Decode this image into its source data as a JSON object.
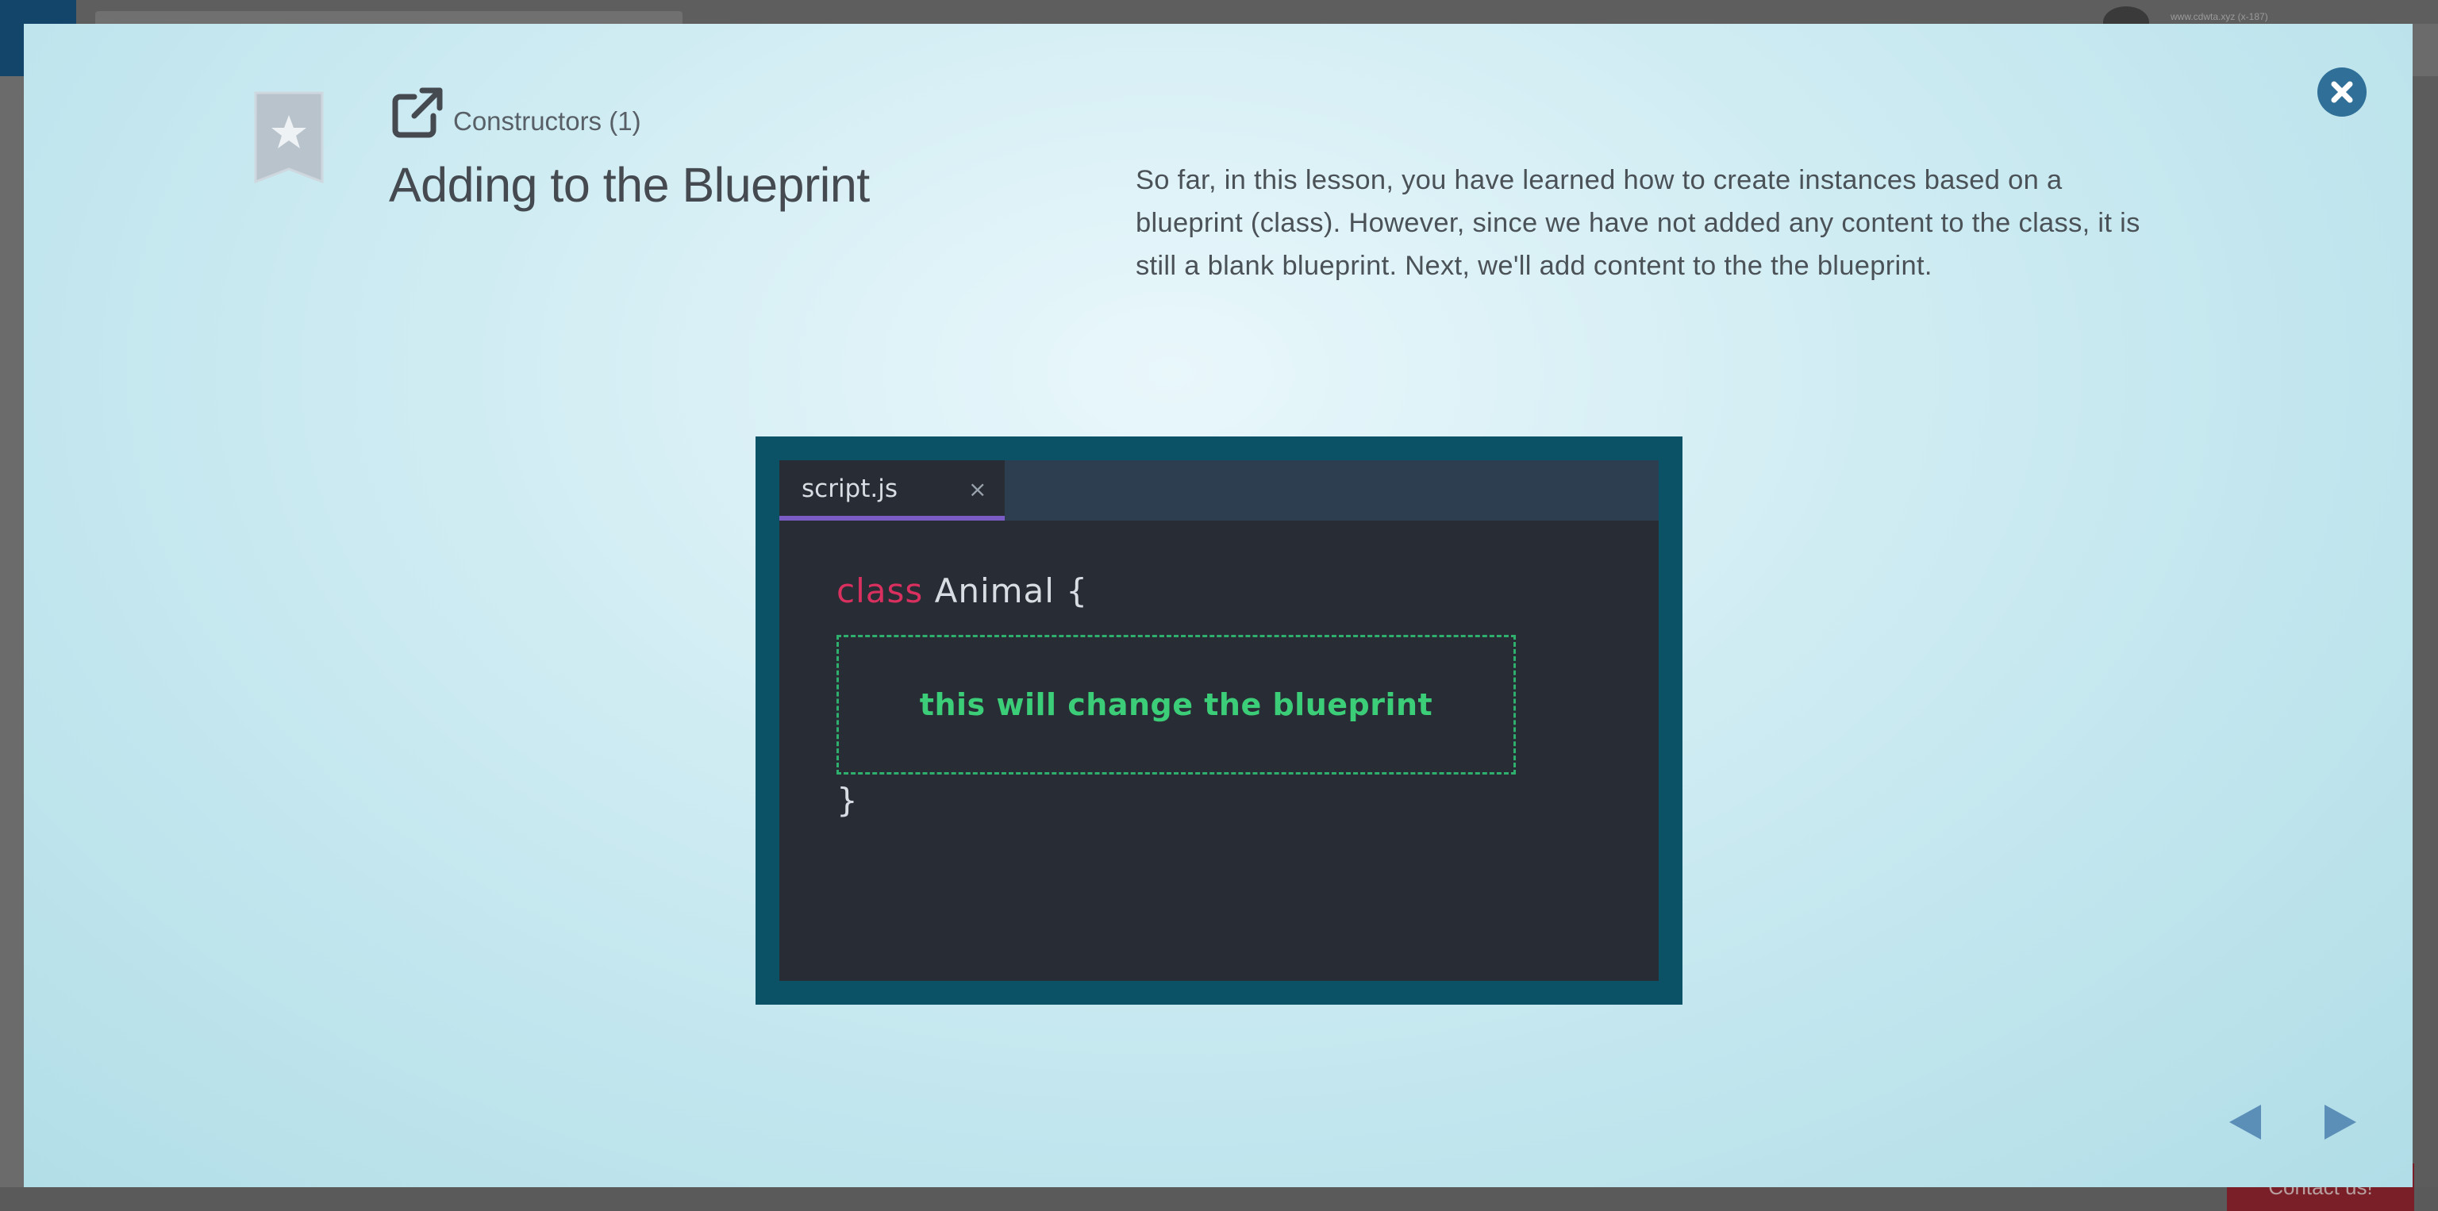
{
  "background_page": {
    "user_label": "www.cdwta.xyz (x-187)",
    "contact_label": "Contact us!"
  },
  "lesson": {
    "breadcrumb": "Constructors (1)",
    "title": "Adding to the Blueprint",
    "description": "So far, in this lesson, you have learned how to create instances based on a blueprint (class). However, since we have not added any content to the class, it is still a blank blueprint. Next, we'll add content to the the blueprint."
  },
  "editor": {
    "tab_label": "script.js",
    "tab_close_glyph": "×",
    "line1_keyword": "class",
    "line1_rest": " Animal {",
    "comment": "this will change the blueprint",
    "closing_brace": "}"
  },
  "icons": {
    "bookmark": "star-bookmark-icon",
    "external_link": "external-link-icon",
    "close": "close-icon",
    "prev": "arrow-left-icon",
    "next": "arrow-right-icon"
  },
  "colors": {
    "accent": "#2f6f98",
    "keyword": "#d9305f",
    "comment": "#3ccd78",
    "tab_underline": "#7b5cc5"
  }
}
